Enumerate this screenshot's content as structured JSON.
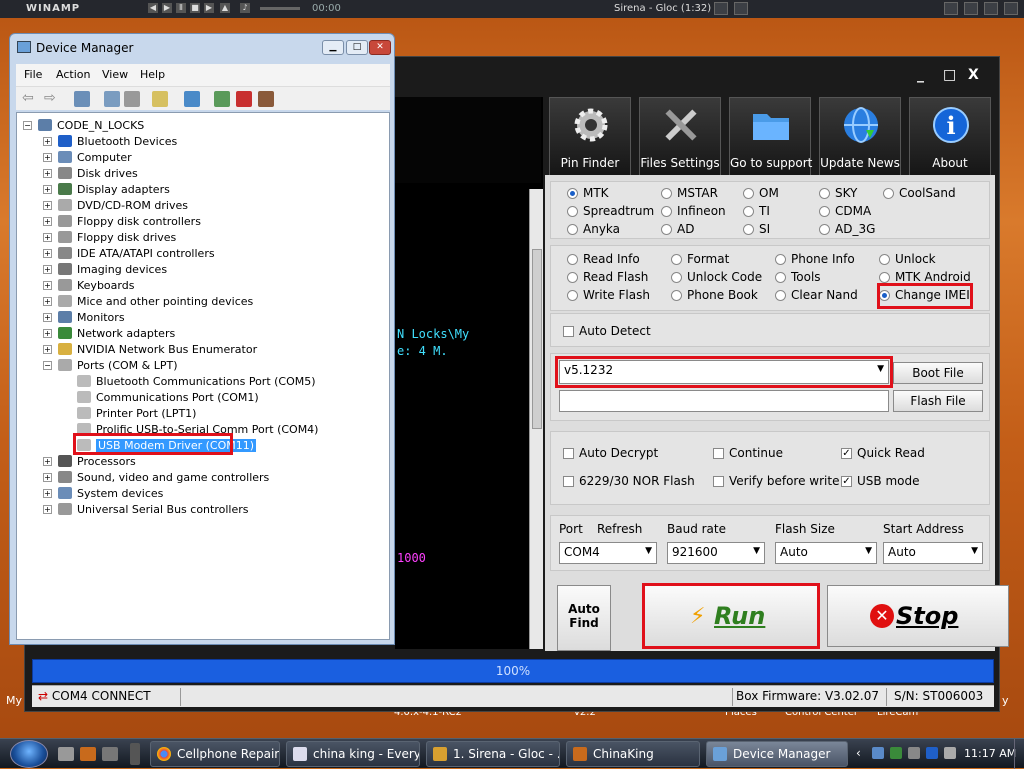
{
  "winamp": {
    "app_name": "WINAMP",
    "time": "00:00",
    "now_playing": "Sirena - Gloc (1:32)"
  },
  "desktop": {
    "labels": [
      "My",
      "4.0.x-4.1-RC2",
      "v2.2",
      "Places",
      "Control Center",
      "LireCam",
      "y"
    ]
  },
  "tool": {
    "window_controls": [
      "_",
      "□",
      "X"
    ],
    "toolbar": [
      {
        "label": "Pin Finder",
        "icon": "gear-icon"
      },
      {
        "label": "Files Settings",
        "icon": "tools-icon"
      },
      {
        "label": "Go to support",
        "icon": "folder-icon"
      },
      {
        "label": "Update News",
        "icon": "globe-icon"
      },
      {
        "label": "About",
        "icon": "info-icon"
      }
    ],
    "console": {
      "line1": "N Locks\\My",
      "line2": "e: 4 M.",
      "line3": "1000"
    },
    "chipsets": {
      "items": [
        "MTK",
        "MSTAR",
        "OM",
        "SKY",
        "CoolSand",
        "Spreadtrum",
        "Infineon",
        "TI",
        "CDMA",
        "Anyka",
        "AD",
        "SI",
        "AD_3G"
      ],
      "selected": "MTK"
    },
    "operations": {
      "items": [
        "Read Info",
        "Format",
        "Phone Info",
        "Unlock",
        "Read Flash",
        "Unlock Code",
        "Tools",
        "MTK Android",
        "Write Flash",
        "Phone Book",
        "Clear Nand",
        "Change IMEI"
      ],
      "selected": "Change IMEI"
    },
    "auto_detect": {
      "label": "Auto Detect",
      "checked": false
    },
    "firmware": {
      "version": "v5.1232",
      "file_path": "",
      "boot_file_label": "Boot File",
      "flash_file_label": "Flash File"
    },
    "options": [
      {
        "label": "Auto Decrypt",
        "checked": false
      },
      {
        "label": "Continue",
        "checked": false
      },
      {
        "label": "Quick Read",
        "checked": true
      },
      {
        "label": "6229/30 NOR Flash",
        "checked": false
      },
      {
        "label": "Verify before write",
        "checked": false
      },
      {
        "label": "USB mode",
        "checked": true
      }
    ],
    "settings": {
      "port_label": "Port",
      "refresh_label": "Refresh",
      "port_value": "COM4",
      "baud_label": "Baud rate",
      "baud_value": "921600",
      "flash_size_label": "Flash Size",
      "flash_size_value": "Auto",
      "start_address_label": "Start Address",
      "start_address_value": "Auto"
    },
    "actions": {
      "auto_find_line1": "Auto",
      "auto_find_line2": "Find",
      "run_label": "Run",
      "stop_label": "Stop"
    },
    "progress": {
      "text": "100%",
      "value": 1.0
    },
    "status": {
      "connection": "COM4 CONNECT",
      "firmware": "Box Firmware: V3.02.07",
      "serial": "S/N: ST006003"
    }
  },
  "device_manager": {
    "title": "Device Manager",
    "menu": [
      "File",
      "Action",
      "View",
      "Help"
    ],
    "root": "CODE_N_LOCKS",
    "categories": [
      "Bluetooth Devices",
      "Computer",
      "Disk drives",
      "Display adapters",
      "DVD/CD-ROM drives",
      "Floppy disk controllers",
      "Floppy disk drives",
      "IDE ATA/ATAPI controllers",
      "Imaging devices",
      "Keyboards",
      "Mice and other pointing devices",
      "Monitors",
      "Network adapters",
      "NVIDIA Network Bus Enumerator",
      "Ports (COM & LPT)"
    ],
    "ports": [
      "Bluetooth Communications Port (COM5)",
      "Communications Port (COM1)",
      "Printer Port (LPT1)",
      "Prolific USB-to-Serial Comm Port (COM4)",
      "USB Modem Driver (COM11)"
    ],
    "categories_after": [
      "Processors",
      "Sound, video and game controllers",
      "System devices",
      "Universal Serial Bus controllers"
    ]
  },
  "taskbar": {
    "items": [
      {
        "label": "Cellphone Repairs...",
        "active": false
      },
      {
        "label": "china king - Every...",
        "active": false
      },
      {
        "label": "1. Sirena - Gloc - ...",
        "active": false
      },
      {
        "label": "ChinaKing",
        "active": false
      },
      {
        "label": "Device Manager",
        "active": true
      }
    ],
    "clock": "11:17 AM"
  },
  "colors": {
    "highlight_red": "#e0101a",
    "progress_blue": "#1a5fe0",
    "console_cyan": "#40e0ff",
    "console_magenta": "#ff40ff",
    "run_green": "#2f7f1f",
    "selection_blue": "#3399ff"
  }
}
